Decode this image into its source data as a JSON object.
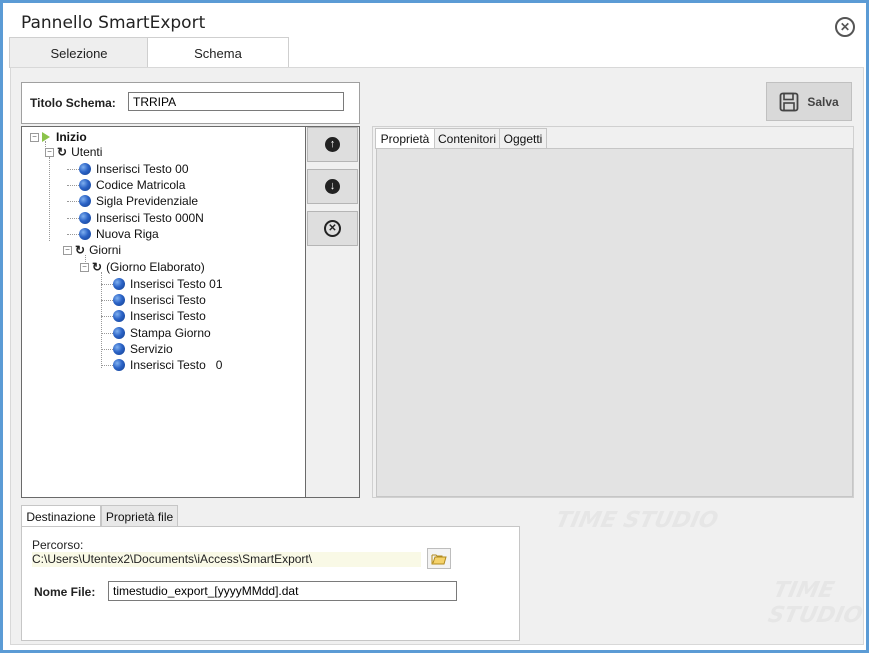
{
  "window": {
    "title": "Pannello SmartExport"
  },
  "tabs": [
    {
      "label": "Selezione",
      "active": false
    },
    {
      "label": "Schema",
      "active": true
    }
  ],
  "schema": {
    "title_label": "Titolo Schema:",
    "title_value": "TRRIPA",
    "save_label": "Salva"
  },
  "tree": {
    "root": "Inizio",
    "utenti": {
      "label": "Utenti",
      "children": [
        "Inserisci Testo 00",
        "Codice Matricola",
        "Sigla Previdenziale",
        "Inserisci Testo 000N",
        "Nuova Riga"
      ]
    },
    "giorni": {
      "label": "Giorni",
      "elaborato": {
        "label": "(Giorno Elaborato)",
        "children": [
          "Inserisci Testo 01",
          "Inserisci Testo",
          "Inserisci Testo",
          "Stampa Giorno",
          "Servizio",
          "Inserisci Testo   0"
        ]
      }
    }
  },
  "properties_tabs": [
    "Proprietà",
    "Contenitori",
    "Oggetti"
  ],
  "bottom_tabs": [
    "Destinazione",
    "Proprietà file"
  ],
  "destination": {
    "path_label": "Percorso:",
    "path_value": "C:\\Users\\Utentex2\\Documents\\iAccess\\SmartExport\\",
    "filename_label": "Nome File:",
    "filename_value": "timestudio_export_[yyyyMMdd].dat"
  },
  "watermark": {
    "texts": [
      "TIME STUDIO"
    ]
  },
  "colors": {
    "frame": "#5b9bd5",
    "node_ball": "#2b63c6",
    "start_arrow": "#8bc34a",
    "path_bg": "#f9f9e6"
  }
}
